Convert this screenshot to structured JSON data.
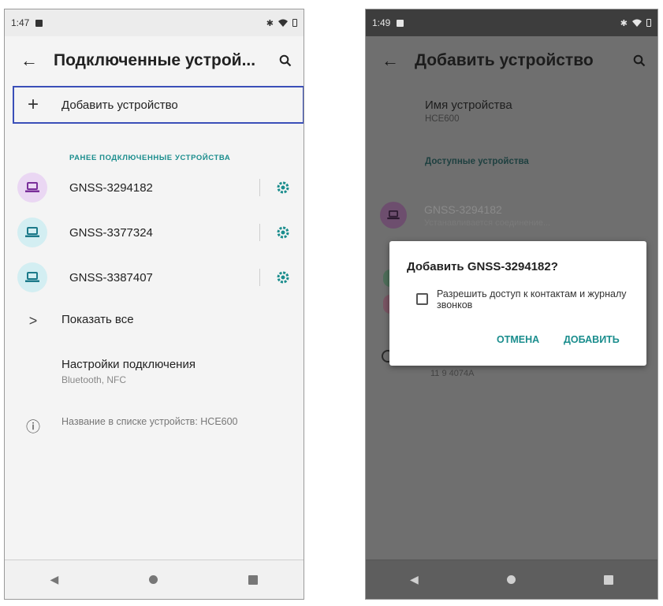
{
  "left_screen": {
    "status": {
      "time": "1:47",
      "right_icons": "✱"
    },
    "appbar": {
      "back": "←",
      "title": "Подключенные устрой...",
      "search_icon": "search-icon"
    },
    "add_device": {
      "plus": "+",
      "label": "Добавить устройство"
    },
    "section_header": "РАНЕЕ ПОДКЛЮЧЕННЫЕ УСТРОЙСТВА",
    "devices": [
      {
        "name": "GNSS-3294182",
        "icon_bg": "#ead7f3",
        "icon_color": "#7a2f9a"
      },
      {
        "name": "GNSS-3377324",
        "icon_bg": "#d3eef2",
        "icon_color": "#1c7a8a"
      },
      {
        "name": "GNSS-3387407",
        "icon_bg": "#d3eef2",
        "icon_color": "#1c7a8a"
      }
    ],
    "show_all": {
      "chevron": ">",
      "label": "Показать все"
    },
    "connection_settings": {
      "label": "Настройки подключения",
      "sub": "Bluetooth, NFC"
    },
    "info": {
      "icon": "ⓘ",
      "text": "Название в списке устройств: HCE600"
    },
    "accent": "#1a8d8d"
  },
  "right_screen": {
    "status": {
      "time": "1:49",
      "right_icons": "✱"
    },
    "appbar": {
      "back": "←",
      "title": "Добавить устройство"
    },
    "device_name": {
      "label": "Имя устройства",
      "value": "HCE600"
    },
    "available_header": "Доступные устройства",
    "pairing_device": {
      "name": "GNSS-3294182",
      "sub": "Устанавливается соединение..."
    },
    "background_fragment": "11 9 4074A",
    "dialog": {
      "title": "Добавить GNSS-3294182?",
      "checkbox_label": "Разрешить доступ к контактам и журналу звонков",
      "cancel": "ОТМЕНА",
      "add": "ДОБАВИТЬ"
    }
  },
  "navbar": {
    "back": "◀"
  }
}
